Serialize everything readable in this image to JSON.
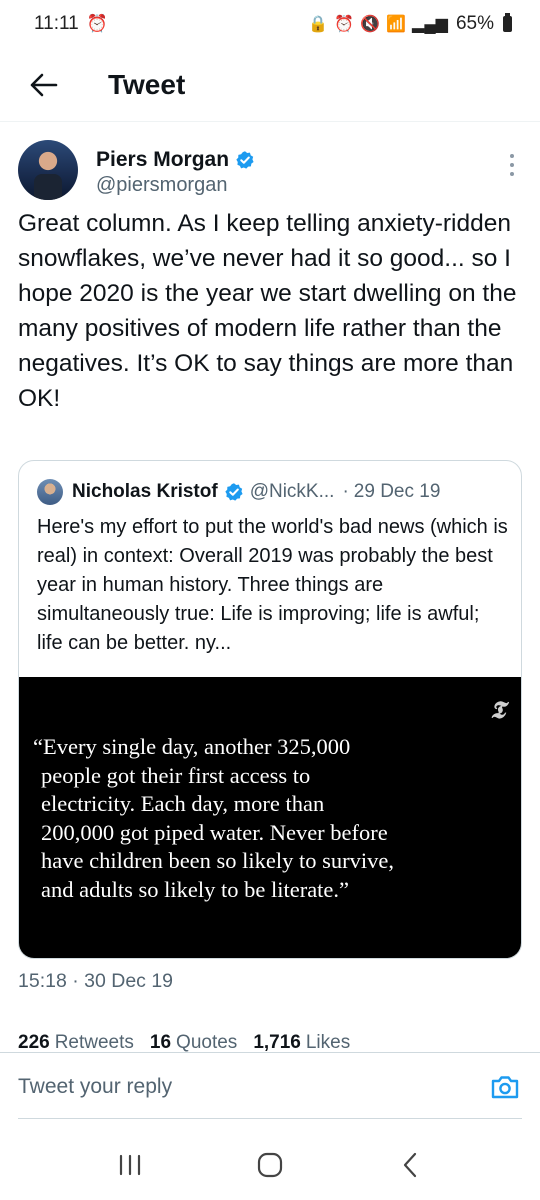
{
  "status_bar": {
    "time": "11:11",
    "battery": "65%",
    "icons": [
      "alarm-icon",
      "lock-icon",
      "alarm-icon",
      "mute-icon",
      "wifi-icon",
      "call-icon",
      "signal-icon",
      "battery-icon"
    ]
  },
  "header": {
    "title": "Tweet",
    "back_icon": "arrow-left-icon"
  },
  "tweet": {
    "author_name": "Piers Morgan",
    "author_handle": "@piersmorgan",
    "text": "Great column. As I keep telling anxiety-ridden snowflakes, we’ve never had it so good... so I hope 2020 is the year we start dwelling on the many positives of modern life rather than the negatives. It’s OK to say things are more than OK!",
    "timestamp": "15:18 · 30 Dec 19"
  },
  "quote": {
    "author_name": "Nicholas Kristof",
    "author_handle": "@NickK...",
    "separator": "·",
    "date": "29 Dec 19",
    "text": "Here's my effort to put the world's bad news (which is real) in context: Overall 2019 was probably the best year in human history. Three things are simultaneously true: Life is improving; life is awful; life can be better. ny...",
    "image_logo": "𝕿",
    "image_lines": [
      "“Every single day, another 325,000",
      "people got their first access to",
      "electricity. Each day, more than",
      "200,000 got piped water. Never before",
      "have children been so likely to survive,",
      "and adults so likely to be literate.”"
    ]
  },
  "stats": {
    "retweets_count": "226",
    "retweets_label": "Retweets",
    "quotes_count": "16",
    "quotes_label": "Quotes",
    "likes_count": "1,716",
    "likes_label": "Likes"
  },
  "reply": {
    "placeholder": "Tweet your reply"
  },
  "colors": {
    "accent": "#1d9bf0",
    "secondary_text": "#536471",
    "border": "#cfd9de"
  }
}
